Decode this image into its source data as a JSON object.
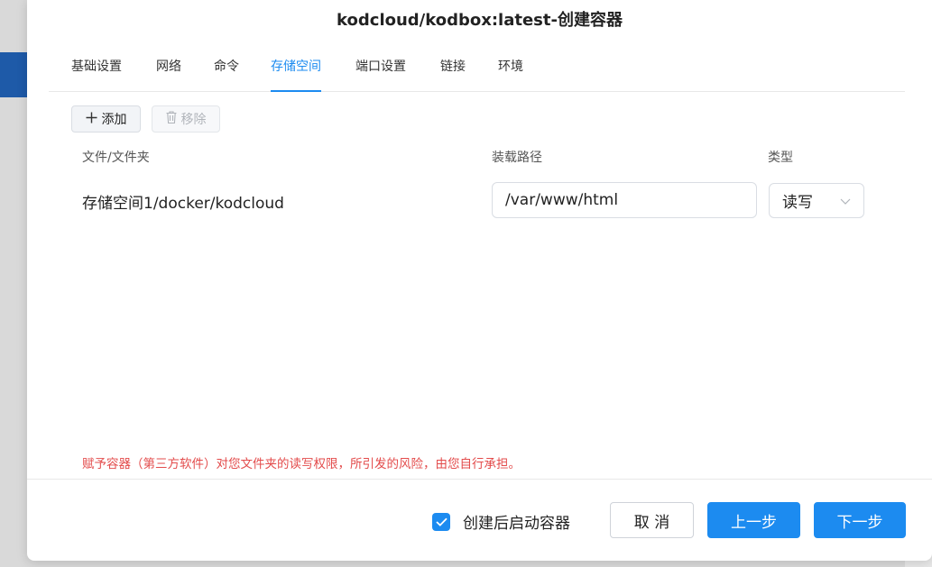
{
  "dialog": {
    "title": "kodcloud/kodbox:latest-创建容器"
  },
  "tabs": [
    {
      "label": "基础设置"
    },
    {
      "label": "网络"
    },
    {
      "label": "命令"
    },
    {
      "label": "存储空间",
      "active": true
    },
    {
      "label": "端口设置"
    },
    {
      "label": "链接"
    },
    {
      "label": "环境"
    }
  ],
  "toolbar": {
    "add_label": "添加",
    "remove_label": "移除"
  },
  "table": {
    "columns": [
      "文件/文件夹",
      "装载路径",
      "类型"
    ],
    "rows": [
      {
        "source": "存储空间1/docker/kodcloud",
        "mount_path": "/var/www/html",
        "type": "读写"
      }
    ]
  },
  "warning": "赋予容器（第三方软件）对您文件夹的读写权限，所引发的风险，由您自行承担。",
  "footer": {
    "start_after_create_label": "创建后启动容器",
    "start_after_create_checked": true,
    "cancel_label": "取 消",
    "prev_label": "上一步",
    "next_label": "下一步"
  },
  "colors": {
    "accent": "#1c8bf0",
    "warning": "#e34b4b"
  }
}
